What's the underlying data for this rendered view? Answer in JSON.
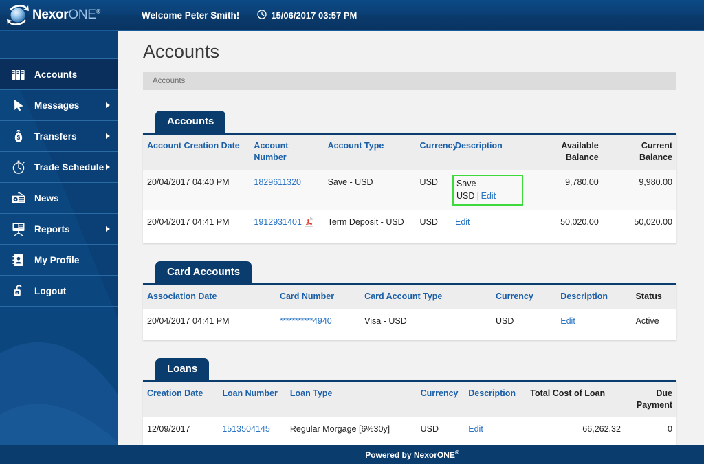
{
  "header": {
    "logo_name": "NexorONE",
    "logo_primary": "Nexor",
    "logo_secondary": "ONE",
    "logo_registered": "®",
    "welcome_prefix": "Welcome ",
    "user_name": "Peter Smith!",
    "datetime": "15/06/2017 03:57 PM",
    "clock_icon": "clock-icon"
  },
  "sidebar": {
    "items": [
      {
        "label": "Accounts",
        "icon": "binders-icon",
        "active": true,
        "has_submenu": false
      },
      {
        "label": "Messages",
        "icon": "cursor-arrow-icon",
        "active": false,
        "has_submenu": true
      },
      {
        "label": "Transfers",
        "icon": "money-bag-icon",
        "active": false,
        "has_submenu": true
      },
      {
        "label": "Trade Schedule",
        "icon": "stopwatch-icon",
        "active": false,
        "has_submenu": true
      },
      {
        "label": "News",
        "icon": "radio-icon",
        "active": false,
        "has_submenu": false
      },
      {
        "label": "Reports",
        "icon": "projector-icon",
        "active": false,
        "has_submenu": true
      },
      {
        "label": "My Profile",
        "icon": "contact-card-icon",
        "active": false,
        "has_submenu": false
      },
      {
        "label": "Logout",
        "icon": "padlock-open-icon",
        "active": false,
        "has_submenu": false
      }
    ]
  },
  "main": {
    "page_title": "Accounts",
    "breadcrumb": "Accounts"
  },
  "accounts_panel": {
    "tab_label": "Accounts",
    "columns": [
      {
        "label": "Account Creation Date",
        "align": "left",
        "style": "link"
      },
      {
        "label": "Account Number",
        "align": "left",
        "style": "link"
      },
      {
        "label": "Account Type",
        "align": "left",
        "style": "link"
      },
      {
        "label": "Currency",
        "align": "left",
        "style": "link"
      },
      {
        "label": "Description",
        "align": "left",
        "style": "link"
      },
      {
        "label": "Available Balance",
        "align": "right",
        "style": "dark"
      },
      {
        "label": "Current Balance",
        "align": "right",
        "style": "dark"
      }
    ],
    "rows": [
      {
        "creation_date": "20/04/2017 04:40 PM",
        "account_number": "1829611320",
        "has_pdf": false,
        "account_type": "Save - USD",
        "currency": "USD",
        "description_text": "Save - USD",
        "description_separator": "|",
        "description_edit": "Edit",
        "highlighted": true,
        "available_balance": "9,780.00",
        "current_balance": "9,980.00"
      },
      {
        "creation_date": "20/04/2017 04:41 PM",
        "account_number": "1912931401",
        "has_pdf": true,
        "pdf_icon": "pdf-file-icon",
        "account_type": "Term Deposit - USD",
        "currency": "USD",
        "description_text": "",
        "description_separator": "",
        "description_edit": "Edit",
        "highlighted": false,
        "available_balance": "50,020.00",
        "current_balance": "50,020.00"
      }
    ]
  },
  "card_accounts_panel": {
    "tab_label": "Card Accounts",
    "columns": [
      {
        "label": "Association Date",
        "align": "left",
        "style": "link"
      },
      {
        "label": "Card Number",
        "align": "left",
        "style": "link"
      },
      {
        "label": "Card Account Type",
        "align": "left",
        "style": "link"
      },
      {
        "label": "Currency",
        "align": "left",
        "style": "link"
      },
      {
        "label": "Description",
        "align": "left",
        "style": "link"
      },
      {
        "label": "Status",
        "align": "left",
        "style": "dark"
      }
    ],
    "rows": [
      {
        "association_date": "20/04/2017 04:41 PM",
        "card_number_mask": "***********",
        "card_number_last4": "4940",
        "card_account_type": "Visa - USD",
        "currency": "USD",
        "description_edit": "Edit",
        "status": "Active"
      }
    ]
  },
  "loans_panel": {
    "tab_label": "Loans",
    "columns": [
      {
        "label": "Creation Date",
        "align": "left",
        "style": "link"
      },
      {
        "label": "Loan Number",
        "align": "left",
        "style": "link"
      },
      {
        "label": "Loan Type",
        "align": "left",
        "style": "link"
      },
      {
        "label": "Currency",
        "align": "left",
        "style": "link"
      },
      {
        "label": "Description",
        "align": "left",
        "style": "link"
      },
      {
        "label": "Total Cost of Loan",
        "align": "right",
        "style": "dark"
      },
      {
        "label": "Due Payment",
        "align": "right",
        "style": "dark"
      }
    ],
    "rows": [
      {
        "creation_date": "12/09/2017",
        "loan_number": "1513504145",
        "loan_type": "Regular Morgage [6%30y]",
        "currency": "USD",
        "description_edit": "Edit",
        "total_cost": "66,262.32",
        "due_payment": "0"
      }
    ]
  },
  "footer": {
    "text": "Powered by NexorONE",
    "registered": "®"
  },
  "colors": {
    "brand_dark_blue": "#0b3c6e",
    "brand_blue": "#0b4076",
    "link_blue": "#2a74c4",
    "header_link_blue": "#1b5fa8",
    "highlight_green": "#3dd93d",
    "page_bg": "#f2f2f2",
    "breadcrumb_bg": "#dcdcdc"
  }
}
